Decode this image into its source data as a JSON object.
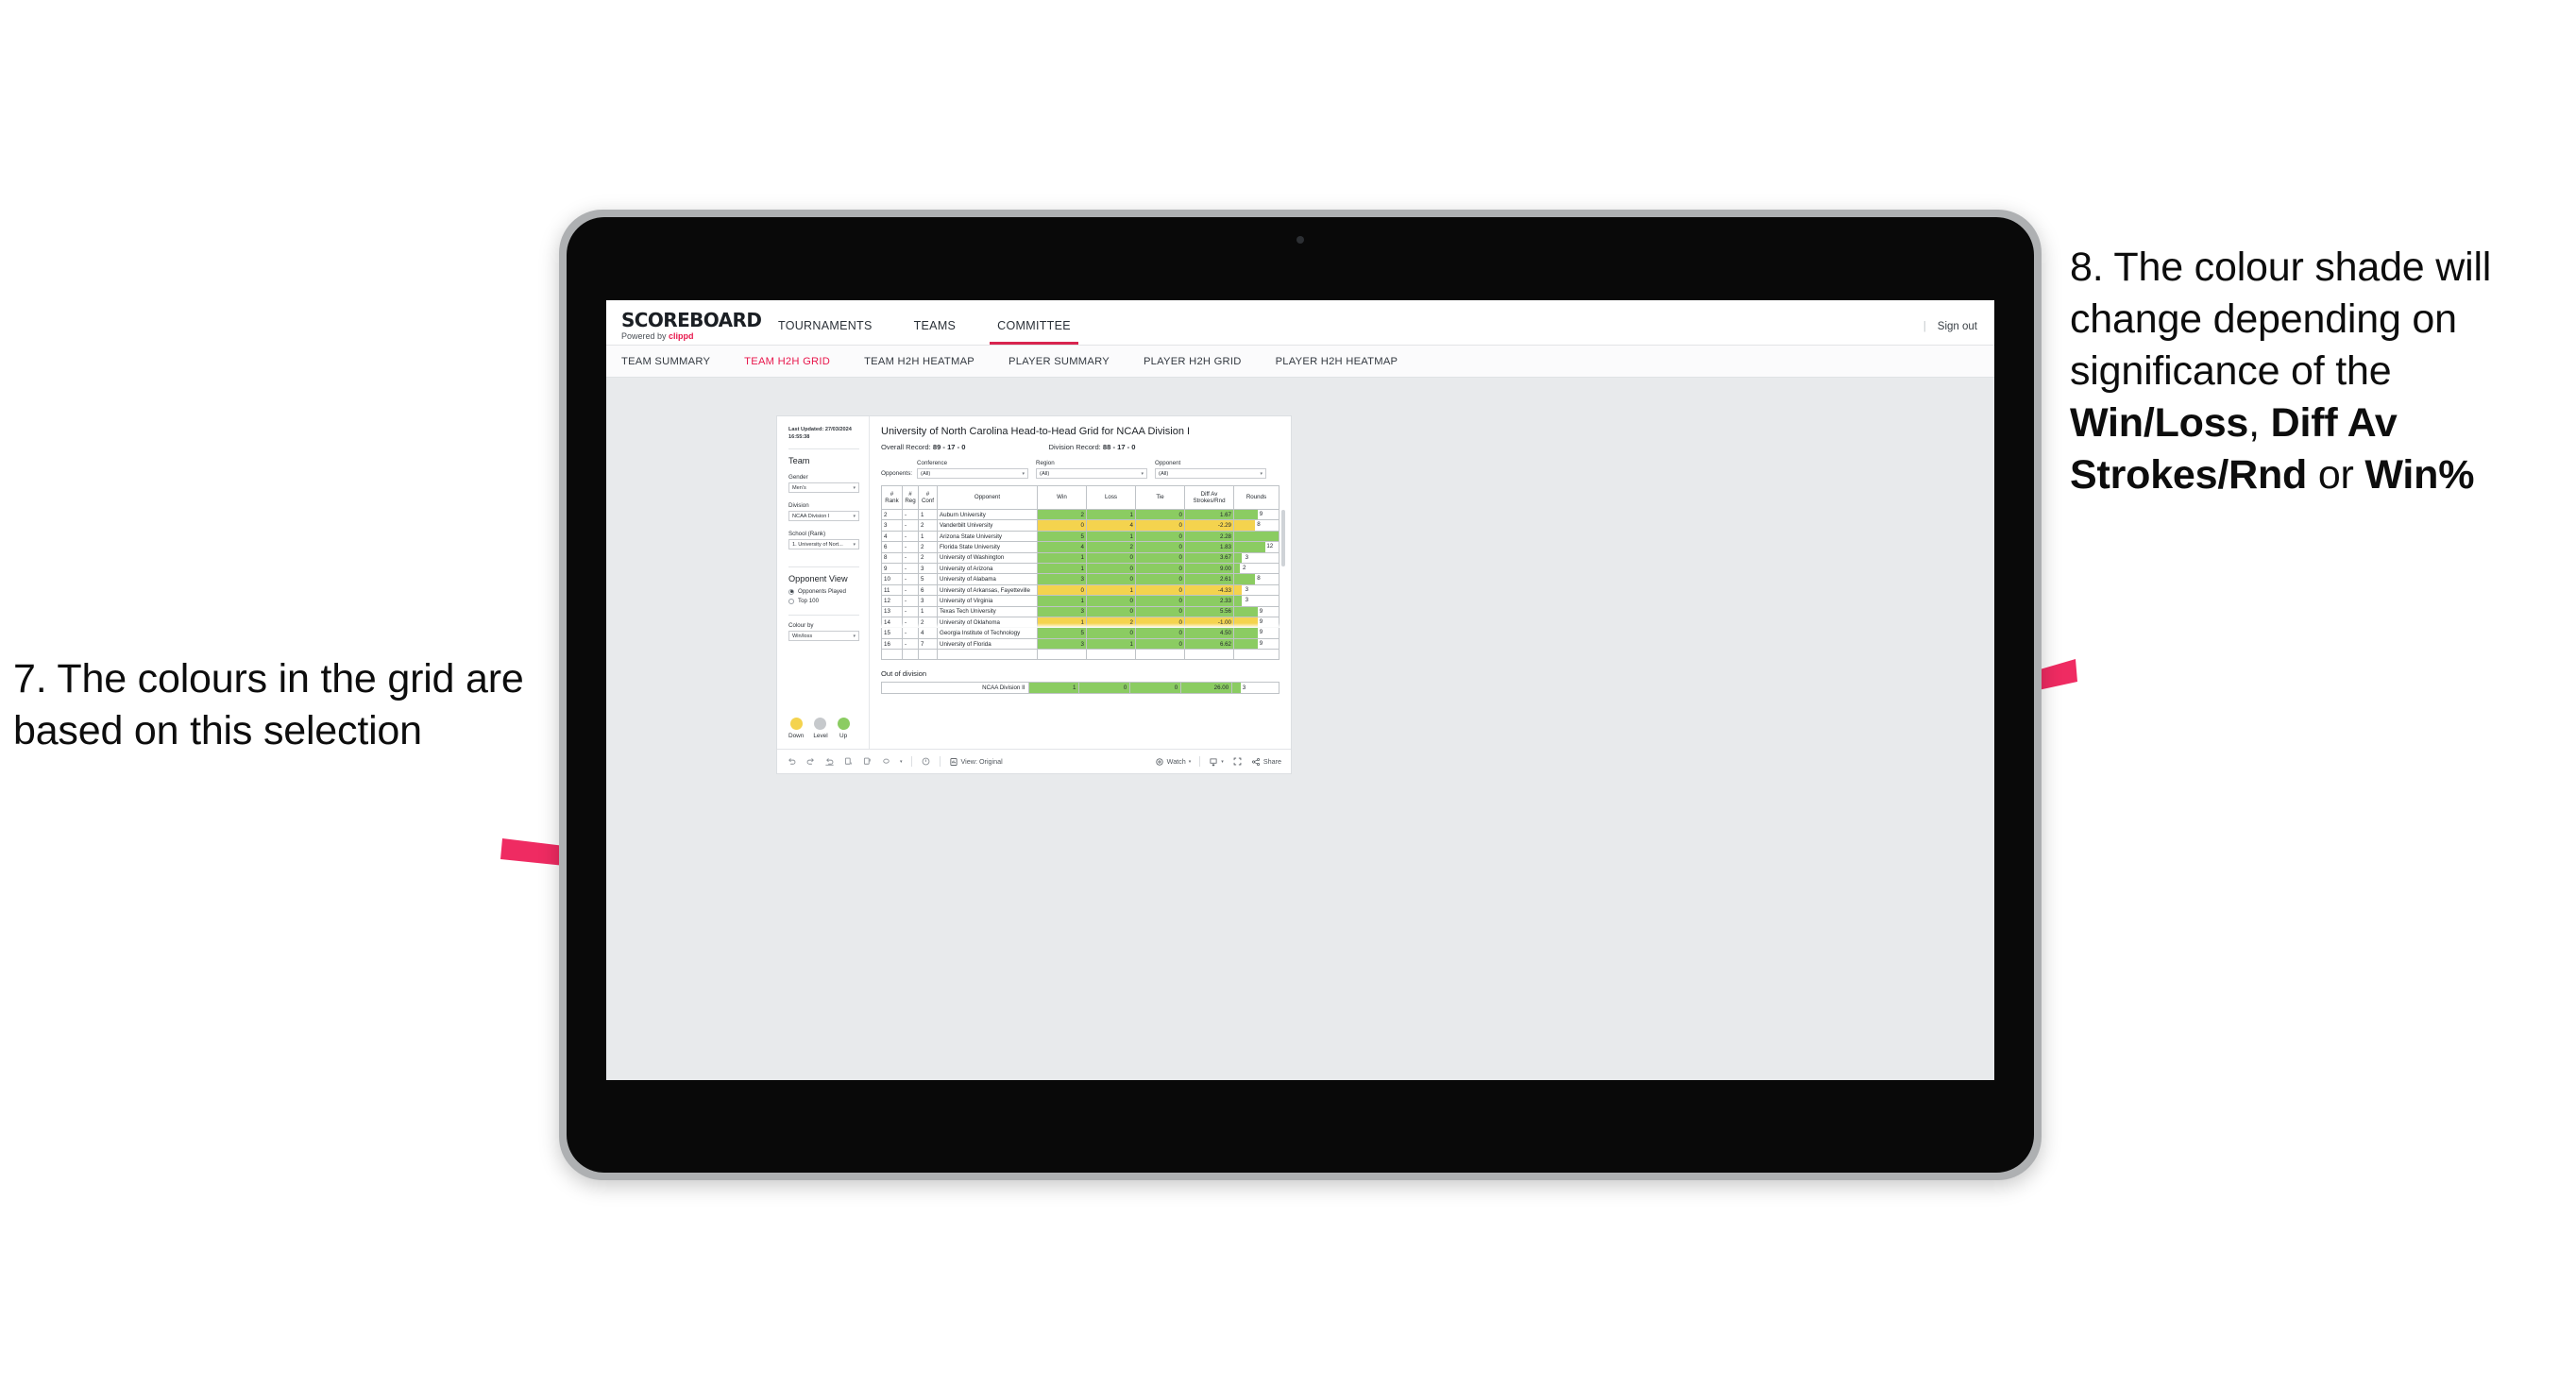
{
  "annotations": {
    "left": {
      "id": "7",
      "text": "7. The colours in the grid are based on this selection"
    },
    "right": {
      "id": "8",
      "part1": "8. The colour shade will change depending on significance of the ",
      "bold1": "Win/Loss",
      "mid1": ", ",
      "bold2": "Diff Av Strokes/Rnd",
      "mid2": " or ",
      "bold3": "Win%"
    },
    "arrow_color": "#ef2b62"
  },
  "app": {
    "brand": {
      "name": "SCOREBOARD",
      "powered_prefix": "Powered by ",
      "powered_by": "clippd"
    },
    "topnav": [
      {
        "label": "TOURNAMENTS",
        "active": false
      },
      {
        "label": "TEAMS",
        "active": false
      },
      {
        "label": "COMMITTEE",
        "active": true
      }
    ],
    "topbar_right": {
      "divider": "|",
      "sign_out": "Sign out"
    },
    "subnav": [
      {
        "label": "TEAM SUMMARY",
        "active": false
      },
      {
        "label": "TEAM H2H GRID",
        "active": true
      },
      {
        "label": "TEAM H2H HEATMAP",
        "active": false
      },
      {
        "label": "PLAYER SUMMARY",
        "active": false
      },
      {
        "label": "PLAYER H2H GRID",
        "active": false
      },
      {
        "label": "PLAYER H2H HEATMAP",
        "active": false
      }
    ],
    "accent": "#e8174c"
  },
  "sidebar": {
    "last_updated_line1": "Last Updated: 27/03/2024",
    "last_updated_line2": "16:55:38",
    "team_heading": "Team",
    "gender": {
      "label": "Gender",
      "value": "Men's"
    },
    "division": {
      "label": "Division",
      "value": "NCAA Division I"
    },
    "school": {
      "label": "School (Rank)",
      "value": "1. University of Nort..."
    },
    "opponent_view": {
      "heading": "Opponent View",
      "options": [
        {
          "label": "Opponents Played",
          "selected": true
        },
        {
          "label": "Top 100",
          "selected": false
        }
      ]
    },
    "colour_by": {
      "label": "Colour by",
      "value": "Win/loss"
    },
    "legend": [
      {
        "label": "Down",
        "color": "#f4d34e"
      },
      {
        "label": "Level",
        "color": "#c6c9cc"
      },
      {
        "label": "Up",
        "color": "#8bcc62"
      }
    ]
  },
  "main": {
    "title": "University of North Carolina Head-to-Head Grid for NCAA Division I",
    "overall_record_label": "Overall Record: ",
    "overall_record_value": "89 - 17 - 0",
    "division_record_label": "Division Record: ",
    "division_record_value": "88 - 17 - 0",
    "opponents_label": "Opponents:",
    "filters": [
      {
        "label": "Conference",
        "value": "(All)"
      },
      {
        "label": "Region",
        "value": "(All)"
      },
      {
        "label": "Opponent",
        "value": "(All)"
      }
    ],
    "columns": [
      "# Rank",
      "# Reg",
      "# Conf",
      "Opponent",
      "Win",
      "Loss",
      "Tie",
      "Diff Av Strokes/Rnd",
      "Rounds"
    ],
    "column_labels": {
      "rank_l1": "#",
      "rank_l2": "Rank",
      "reg_l1": "#",
      "reg_l2": "Reg",
      "conf_l1": "#",
      "conf_l2": "Conf",
      "opponent": "Opponent",
      "win": "Win",
      "loss": "Loss",
      "tie": "Tie",
      "diff_l1": "Diff Av",
      "diff_l2": "Strokes/Rnd",
      "rounds": "Rounds"
    },
    "rows": [
      {
        "rank": "2",
        "reg": "-",
        "conf": "1",
        "opponent": "Auburn University",
        "win": "2",
        "loss": "1",
        "tie": "0",
        "diff": "1.67",
        "rounds": "9",
        "tone": "up"
      },
      {
        "rank": "3",
        "reg": "-",
        "conf": "2",
        "opponent": "Vanderbilt University",
        "win": "0",
        "loss": "4",
        "tie": "0",
        "diff": "-2.29",
        "rounds": "8",
        "tone": "down"
      },
      {
        "rank": "4",
        "reg": "-",
        "conf": "1",
        "opponent": "Arizona State University",
        "win": "5",
        "loss": "1",
        "tie": "0",
        "diff": "2.28",
        "rounds": "17",
        "tone": "up"
      },
      {
        "rank": "6",
        "reg": "-",
        "conf": "2",
        "opponent": "Florida State University",
        "win": "4",
        "loss": "2",
        "tie": "0",
        "diff": "1.83",
        "rounds": "12",
        "tone": "up"
      },
      {
        "rank": "8",
        "reg": "-",
        "conf": "2",
        "opponent": "University of Washington",
        "win": "1",
        "loss": "0",
        "tie": "0",
        "diff": "3.67",
        "rounds": "3",
        "tone": "up"
      },
      {
        "rank": "9",
        "reg": "-",
        "conf": "3",
        "opponent": "University of Arizona",
        "win": "1",
        "loss": "0",
        "tie": "0",
        "diff": "9.00",
        "rounds": "2",
        "tone": "up"
      },
      {
        "rank": "10",
        "reg": "-",
        "conf": "5",
        "opponent": "University of Alabama",
        "win": "3",
        "loss": "0",
        "tie": "0",
        "diff": "2.61",
        "rounds": "8",
        "tone": "up"
      },
      {
        "rank": "11",
        "reg": "-",
        "conf": "6",
        "opponent": "University of Arkansas, Fayetteville",
        "win": "0",
        "loss": "1",
        "tie": "0",
        "diff": "-4.33",
        "rounds": "3",
        "tone": "down"
      },
      {
        "rank": "12",
        "reg": "-",
        "conf": "3",
        "opponent": "University of Virginia",
        "win": "1",
        "loss": "0",
        "tie": "0",
        "diff": "2.33",
        "rounds": "3",
        "tone": "up"
      },
      {
        "rank": "13",
        "reg": "-",
        "conf": "1",
        "opponent": "Texas Tech University",
        "win": "3",
        "loss": "0",
        "tie": "0",
        "diff": "5.56",
        "rounds": "9",
        "tone": "up"
      },
      {
        "rank": "14",
        "reg": "-",
        "conf": "2",
        "opponent": "University of Oklahoma",
        "win": "1",
        "loss": "2",
        "tie": "0",
        "diff": "-1.00",
        "rounds": "9",
        "tone": "down"
      },
      {
        "rank": "15",
        "reg": "-",
        "conf": "4",
        "opponent": "Georgia Institute of Technology",
        "win": "5",
        "loss": "0",
        "tie": "0",
        "diff": "4.50",
        "rounds": "9",
        "tone": "up"
      },
      {
        "rank": "16",
        "reg": "-",
        "conf": "7",
        "opponent": "University of Florida",
        "win": "3",
        "loss": "1",
        "tie": "0",
        "diff": "6.62",
        "rounds": "9",
        "tone": "up"
      }
    ],
    "out_of_division": {
      "title": "Out of division",
      "row": {
        "name": "NCAA Division II",
        "win": "1",
        "loss": "0",
        "tie": "0",
        "diff": "26.00",
        "rounds": "3",
        "tone": "up"
      }
    },
    "colors": {
      "up": "#8bcc62",
      "down": "#f4d34e",
      "level": "#c6c9cc"
    },
    "rounds_max": 17
  },
  "toolbar": {
    "icons": [
      "undo-icon",
      "redo-icon",
      "revert-icon",
      "pause-icon",
      "resume-icon",
      "refresh-icon",
      "alert-icon"
    ],
    "view_label": "View: Original",
    "watch_label": "Watch",
    "share_label": "Share"
  },
  "chart_data": {
    "type": "table",
    "title": "University of North Carolina Head-to-Head Grid for NCAA Division I",
    "columns": [
      "# Rank",
      "# Reg",
      "# Conf",
      "Opponent",
      "Win",
      "Loss",
      "Tie",
      "Diff Av Strokes/Rnd",
      "Rounds"
    ],
    "colour_by": "Win/loss",
    "legend": {
      "Down": "#f4d34e",
      "Level": "#c6c9cc",
      "Up": "#8bcc62"
    },
    "rounds_axis_max": 17,
    "rows": [
      {
        "rank": 2,
        "conf": 1,
        "opponent": "Auburn University",
        "win": 2,
        "loss": 1,
        "tie": 0,
        "diff": 1.67,
        "rounds": 9,
        "tone": "up"
      },
      {
        "rank": 3,
        "conf": 2,
        "opponent": "Vanderbilt University",
        "win": 0,
        "loss": 4,
        "tie": 0,
        "diff": -2.29,
        "rounds": 8,
        "tone": "down"
      },
      {
        "rank": 4,
        "conf": 1,
        "opponent": "Arizona State University",
        "win": 5,
        "loss": 1,
        "tie": 0,
        "diff": 2.28,
        "rounds": 17,
        "tone": "up"
      },
      {
        "rank": 6,
        "conf": 2,
        "opponent": "Florida State University",
        "win": 4,
        "loss": 2,
        "tie": 0,
        "diff": 1.83,
        "rounds": 12,
        "tone": "up"
      },
      {
        "rank": 8,
        "conf": 2,
        "opponent": "University of Washington",
        "win": 1,
        "loss": 0,
        "tie": 0,
        "diff": 3.67,
        "rounds": 3,
        "tone": "up"
      },
      {
        "rank": 9,
        "conf": 3,
        "opponent": "University of Arizona",
        "win": 1,
        "loss": 0,
        "tie": 0,
        "diff": 9.0,
        "rounds": 2,
        "tone": "up"
      },
      {
        "rank": 10,
        "conf": 5,
        "opponent": "University of Alabama",
        "win": 3,
        "loss": 0,
        "tie": 0,
        "diff": 2.61,
        "rounds": 8,
        "tone": "up"
      },
      {
        "rank": 11,
        "conf": 6,
        "opponent": "University of Arkansas, Fayetteville",
        "win": 0,
        "loss": 1,
        "tie": 0,
        "diff": -4.33,
        "rounds": 3,
        "tone": "down"
      },
      {
        "rank": 12,
        "conf": 3,
        "opponent": "University of Virginia",
        "win": 1,
        "loss": 0,
        "tie": 0,
        "diff": 2.33,
        "rounds": 3,
        "tone": "up"
      },
      {
        "rank": 13,
        "conf": 1,
        "opponent": "Texas Tech University",
        "win": 3,
        "loss": 0,
        "tie": 0,
        "diff": 5.56,
        "rounds": 9,
        "tone": "up"
      },
      {
        "rank": 14,
        "conf": 2,
        "opponent": "University of Oklahoma",
        "win": 1,
        "loss": 2,
        "tie": 0,
        "diff": -1.0,
        "rounds": 9,
        "tone": "down"
      },
      {
        "rank": 15,
        "conf": 4,
        "opponent": "Georgia Institute of Technology",
        "win": 5,
        "loss": 0,
        "tie": 0,
        "diff": 4.5,
        "rounds": 9,
        "tone": "up"
      },
      {
        "rank": 16,
        "conf": 7,
        "opponent": "University of Florida",
        "win": 3,
        "loss": 1,
        "tie": 0,
        "diff": 6.62,
        "rounds": 9,
        "tone": "up"
      }
    ],
    "out_of_division": {
      "name": "NCAA Division II",
      "win": 1,
      "loss": 0,
      "tie": 0,
      "diff": 26.0,
      "rounds": 3
    }
  }
}
